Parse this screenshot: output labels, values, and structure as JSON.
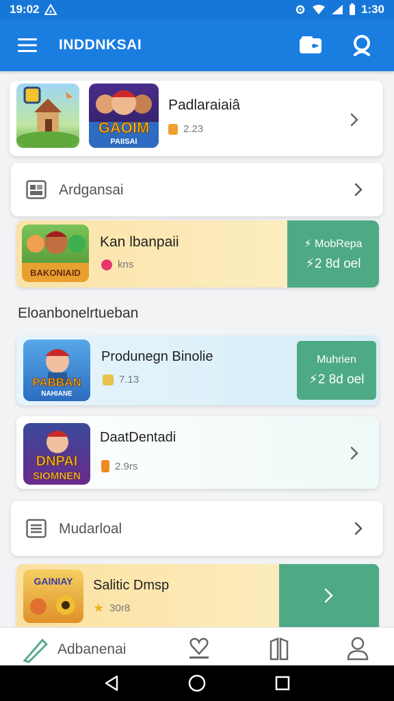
{
  "status_bar": {
    "time_left": "19:02",
    "time_right": "1:30"
  },
  "app_bar": {
    "title": "INDDNKSAI"
  },
  "rows": [
    {
      "title": "Padlaraiaiâ",
      "meta": "2.23",
      "meta_color": "#f0a030"
    },
    {
      "label": "Ardgansai"
    },
    {
      "title": "Kan lbanpaii",
      "meta": "kns",
      "meta_color": "#e8366a",
      "btn_l1": "⚡ MobRepa",
      "btn_l2": "⚡2 8d oel"
    }
  ],
  "section_header": "Eloanbonelrtueban",
  "featured": [
    {
      "title": "Produnegn Binolie",
      "meta": "7.13",
      "meta_color": "#e6c24a",
      "btn_l1": "Muhrien",
      "btn_l2": "⚡2 8d oel"
    },
    {
      "title": "DaatDentadi",
      "meta": "2.9rs",
      "meta_color": "#f08a20"
    }
  ],
  "menu_row": {
    "label": "Mudarloal"
  },
  "last_row": {
    "title": "Salitic Dmsp",
    "meta": "30r8",
    "meta_color": "#f0b020"
  },
  "thumb_texts": {
    "t2": "GAOIM",
    "t2b": "PAIISAI",
    "t3": "BAKONIAID",
    "t4": "PABBAN",
    "t4b": "NAHIANE",
    "t5": "DNPAI",
    "t5b": "SIOMNEN",
    "t6": "GAINIAY"
  },
  "bottom_nav": {
    "active_label": "Adbanenai"
  },
  "colors": {
    "primary": "#1a7de0",
    "accent_green": "#4ea985"
  }
}
